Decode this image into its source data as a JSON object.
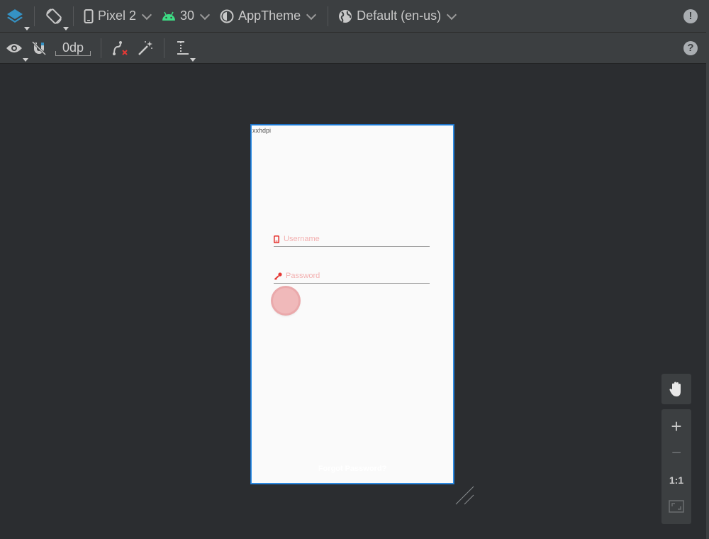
{
  "toolbar_top": {
    "device": "Pixel 2",
    "api_level": "30",
    "theme": "AppTheme",
    "locale": "Default (en-us)",
    "icons": [
      "layers-icon",
      "orientation-icon",
      "phone-icon",
      "android-icon",
      "theme-icon",
      "globe-icon",
      "warning-icon"
    ]
  },
  "toolbar_second": {
    "margin_value": "0dp",
    "icons": [
      "eye-icon",
      "magnet-icon",
      "clear-constraints-icon",
      "infer-constraints-icon",
      "guidelines-icon",
      "help-icon"
    ]
  },
  "device_preview": {
    "density_label": "xxhdpi",
    "username_hint": "Username",
    "password_hint": "Password",
    "forgot_password": "Forgot Password?"
  },
  "zoom_controls": {
    "plus": "+",
    "minus": "−",
    "one_to_one": "1:1"
  },
  "colors": {
    "accent_blue": "#2f8fe6",
    "hint_pink": "#f3b0b0",
    "icon_red": "#e53935",
    "android_green": "#3ddc84"
  }
}
